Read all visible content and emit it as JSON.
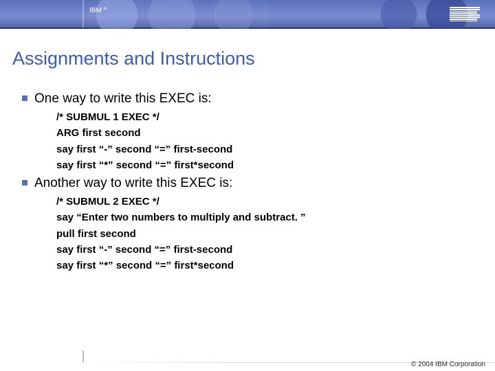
{
  "header": {
    "label": "IBM ^"
  },
  "title": "Assignments and Instructions",
  "sections": [
    {
      "heading": "One way to write this EXEC is:",
      "code": [
        "/* SUBMUL 1 EXEC */",
        "ARG first second",
        "say first “-” second “=” first-second",
        "say first “*” second “=” first*second"
      ]
    },
    {
      "heading": "Another way to write this EXEC is:",
      "code": [
        "/* SUBMUL 2 EXEC */",
        "say “Enter two numbers to multiply and subtract. ”",
        "pull first second",
        "say first “-” second “=” first-second",
        "say first “*” second “=” first*second"
      ]
    }
  ],
  "footer": {
    "copyright": "© 2004 IBM Corporation"
  }
}
